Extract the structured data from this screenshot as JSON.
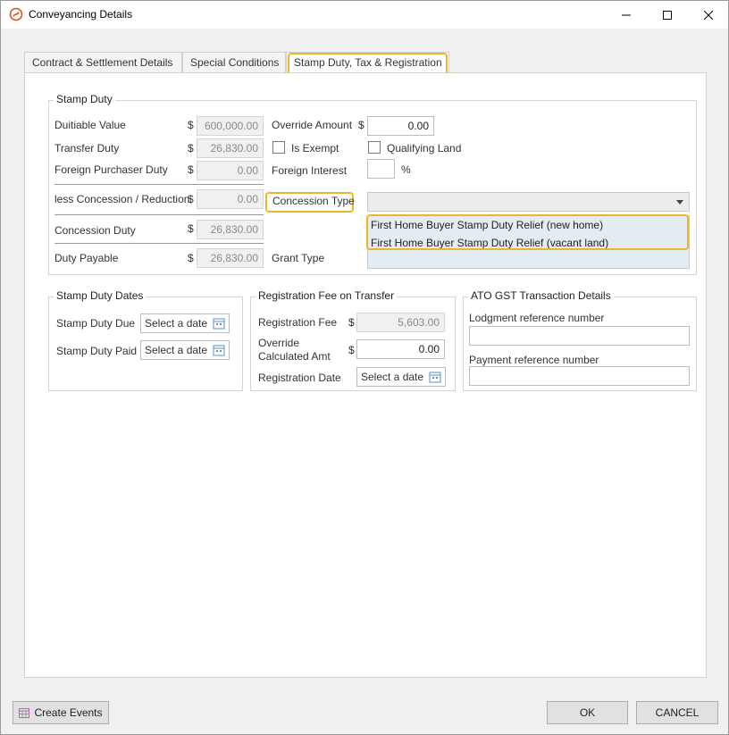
{
  "window": {
    "title": "Conveyancing Details"
  },
  "colors": {
    "highlight": "#f0b429",
    "accent": "#d9531e"
  },
  "tabs": [
    {
      "label": "Contract & Settlement Details"
    },
    {
      "label": "Special Conditions"
    },
    {
      "label": "Stamp Duty, Tax & Registration"
    }
  ],
  "stamp_duty": {
    "title": "Stamp Duty",
    "dutiable_value": {
      "label": "Duitiable Value",
      "currency": "$",
      "value": "600,000.00"
    },
    "transfer_duty": {
      "label": "Transfer Duty",
      "currency": "$",
      "value": "26,830.00"
    },
    "foreign_purchaser_duty": {
      "label": "Foreign Purchaser Duty",
      "currency": "$",
      "value": "0.00"
    },
    "less_concession": {
      "label": "less Concession / Reduction",
      "currency": "$",
      "value": "0.00"
    },
    "concession_duty": {
      "label": "Concession Duty",
      "currency": "$",
      "value": "26,830.00"
    },
    "duty_payable": {
      "label": "Duty Payable",
      "currency": "$",
      "value": "26,830.00"
    },
    "override_amount": {
      "label": "Override Amount",
      "currency": "$",
      "value": "0.00"
    },
    "is_exempt": {
      "label": "Is Exempt",
      "checked": false
    },
    "qualifying_land": {
      "label": "Qualifying Land",
      "checked": false
    },
    "foreign_interest": {
      "label": "Foreign Interest",
      "value": "",
      "unit": "%"
    },
    "concession_type": {
      "label": "Concession Type",
      "value": ""
    },
    "concession_options": [
      "First Home Buyer Stamp Duty Relief (new home)",
      "First Home Buyer Stamp Duty Relief (vacant land)"
    ],
    "grant_type": {
      "label": "Grant Type"
    }
  },
  "stamp_duty_dates": {
    "title": "Stamp Duty Dates",
    "due": {
      "label": "Stamp Duty Due",
      "placeholder": "Select a date"
    },
    "paid": {
      "label": "Stamp Duty Paid",
      "placeholder": "Select a date"
    }
  },
  "registration": {
    "title": "Registration Fee on Transfer",
    "fee": {
      "label": "Registration Fee",
      "currency": "$",
      "value": "5,603.00"
    },
    "override_line1": "Override",
    "override_line2": "Calculated Amt",
    "override_currency": "$",
    "override_value": "0.00",
    "date": {
      "label": "Registration Date",
      "placeholder": "Select a date"
    }
  },
  "ato": {
    "title": "ATO GST Transaction Details",
    "lodgment": {
      "label": "Lodgment reference number",
      "value": ""
    },
    "payment": {
      "label": "Payment reference number",
      "value": ""
    }
  },
  "footer": {
    "create_events": "Create Events",
    "ok": "OK",
    "cancel": "CANCEL"
  }
}
